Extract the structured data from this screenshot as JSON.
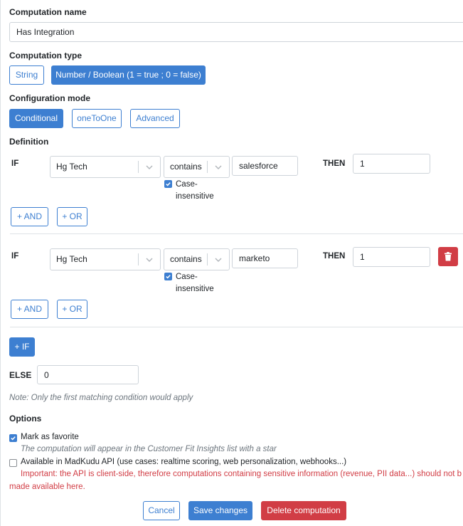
{
  "computation_name": {
    "label": "Computation name",
    "value": "Has Integration"
  },
  "computation_type": {
    "label": "Computation type",
    "options": [
      {
        "label": "String",
        "selected": false
      },
      {
        "label": "Number / Boolean (1 = true ; 0 = false)",
        "selected": true
      }
    ]
  },
  "configuration_mode": {
    "label": "Configuration mode",
    "options": [
      {
        "label": "Conditional",
        "selected": true
      },
      {
        "label": "oneToOne",
        "selected": false
      },
      {
        "label": "Advanced",
        "selected": false
      }
    ]
  },
  "definition": {
    "label": "Definition",
    "conditions": [
      {
        "if_label": "IF",
        "field": "Hg Tech",
        "operator": "contains",
        "value": "salesforce",
        "case_insensitive": {
          "checked": true,
          "label_line1": "Case-",
          "label_line2": "insensitive"
        },
        "then_label": "THEN",
        "then_value": "1",
        "and_label": "+ AND",
        "or_label": "+ OR"
      },
      {
        "if_label": "IF",
        "field": "Hg Tech",
        "operator": "contains",
        "value": "marketo",
        "case_insensitive": {
          "checked": true,
          "label_line1": "Case-",
          "label_line2": "insensitive"
        },
        "then_label": "THEN",
        "then_value": "1",
        "and_label": "+ AND",
        "or_label": "+ OR"
      }
    ],
    "add_if_label": "+ IF",
    "else_label": "ELSE",
    "else_value": "0",
    "note": "Note: Only the first matching condition would apply"
  },
  "options": {
    "label": "Options",
    "favorite": {
      "checked": true,
      "label": "Mark as favorite",
      "hint": "The computation will appear in the Customer Fit Insights list with a star"
    },
    "api": {
      "checked": false,
      "label": "Available in MadKudu API (use cases: realtime scoring, web personalization, webhooks...)",
      "warning_line1": "Important: the API is client-side, therefore computations containing sensitive information (revenue, PII data...) should not be",
      "warning_line2": "made available here."
    }
  },
  "actions": {
    "cancel": "Cancel",
    "save": "Save changes",
    "delete": "Delete computation"
  },
  "colors": {
    "primary": "#3d7fd1",
    "danger": "#d13d45",
    "muted": "#6c757d"
  }
}
